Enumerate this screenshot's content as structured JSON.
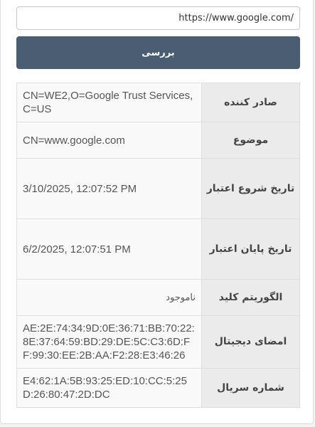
{
  "form": {
    "url_value": "https://www.google.com/",
    "check_label": "بررسی"
  },
  "certificate": {
    "rows": [
      {
        "label": "صادر کننده",
        "value": "CN=WE2,O=Google Trust Services,C=US"
      },
      {
        "label": "موضوع",
        "value": "CN=www.google.com"
      },
      {
        "label": "تاریخ شروع اعتبار",
        "value": "3/10/2025, 12:07:52 PM"
      },
      {
        "label": "تاریخ پایان اعتبار",
        "value": "6/2/2025, 12:07:51 PM"
      },
      {
        "label": "الگوریتم کلید",
        "value": "ناموجود"
      },
      {
        "label": "امضای دیجیتال",
        "value": "AE:2E:74:34:9D:0E:36:71:BB:70:22:8E:37:64:59:BD:29:DE:5C:C3:6D:FF:99:30:EE:2B:AA:F2:28:E3:46:26"
      },
      {
        "label": "شماره سریال",
        "value": "E4:62:1A:5B:93:25:ED:10:CC:5:25D:26:80:47:2D:DC"
      }
    ]
  }
}
